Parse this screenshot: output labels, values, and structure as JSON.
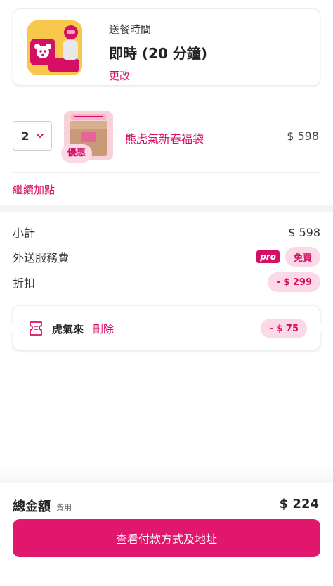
{
  "delivery": {
    "label": "送餐時間",
    "value": "即時 (20 分鐘)",
    "change_link": "更改"
  },
  "cart": {
    "item": {
      "quantity": "2",
      "name": "熊虎氣新春福袋",
      "price": "$ 598",
      "promo_badge": "優惠"
    },
    "add_more": "繼續加點"
  },
  "summary": {
    "subtotal_label": "小計",
    "subtotal_value": "$ 598",
    "delivery_fee_label": "外送服務費",
    "pro_badge": "pro",
    "delivery_fee_value": "免費",
    "discount_label": "折扣",
    "discount_value": "- $ 299"
  },
  "voucher": {
    "name": "虎氣來",
    "delete_label": "刪除",
    "amount": "- $ 75"
  },
  "total": {
    "label": "總金額",
    "sublabel": "費用",
    "value": "$ 224"
  },
  "checkout_button": "查看付款方式及地址",
  "colors": {
    "brand": "#d70f64",
    "brand_light": "#fbd9e6",
    "illustration_bg": "#f8c84d"
  }
}
